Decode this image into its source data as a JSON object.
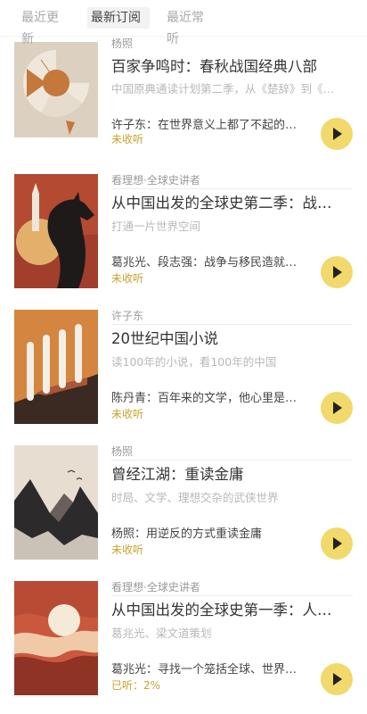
{
  "tabs": [
    {
      "label": "最近更新"
    },
    {
      "label": "最新订阅"
    },
    {
      "label": "最近常听"
    }
  ],
  "courses": [
    {
      "author": "杨照",
      "title": "百家争鸣时：春秋战国经典八部",
      "subtitle": "中国原典通读计划第二季，从《楚辞》到《…",
      "latest": "许子东：在世界意义上都了不起的中…",
      "status": "未收听",
      "cover_icon": "broken-disc-cover"
    },
    {
      "author": "看理想·全球史讲者",
      "title": "从中国出发的全球史第二季：战…",
      "subtitle": "打通一片世界空间",
      "latest": "葛兆光、段志强：战争与移民造就的…",
      "status": "未收听",
      "cover_icon": "horse-and-shield-cover"
    },
    {
      "author": "许子东",
      "title": "20世纪中国小说",
      "subtitle": "读100年的小说，看100年的中国",
      "latest": "陈丹青：百年来的文学，他心里是一…",
      "status": "未收听",
      "cover_icon": "columns-cover"
    },
    {
      "author": "杨照",
      "title": "曾经江湖：重读金庸",
      "subtitle": "时局、文学、理想交杂的武侠世界",
      "latest": "杨照：用逆反的方式重读金庸",
      "status": "未收听",
      "cover_icon": "mountains-cover"
    },
    {
      "author": "看理想·全球史讲者",
      "title": "从中国出发的全球史第一季：人…",
      "subtitle": "葛兆光、梁文道策划",
      "latest": "葛兆光：寻找一个笼括全球、世界互…",
      "status": "已听：2%",
      "cover_icon": "sunset-waves-cover"
    }
  ],
  "colors": {
    "accent": "#f2d96c",
    "status": "#c9a22e",
    "active_tab_bg": "#f2f2f2"
  }
}
